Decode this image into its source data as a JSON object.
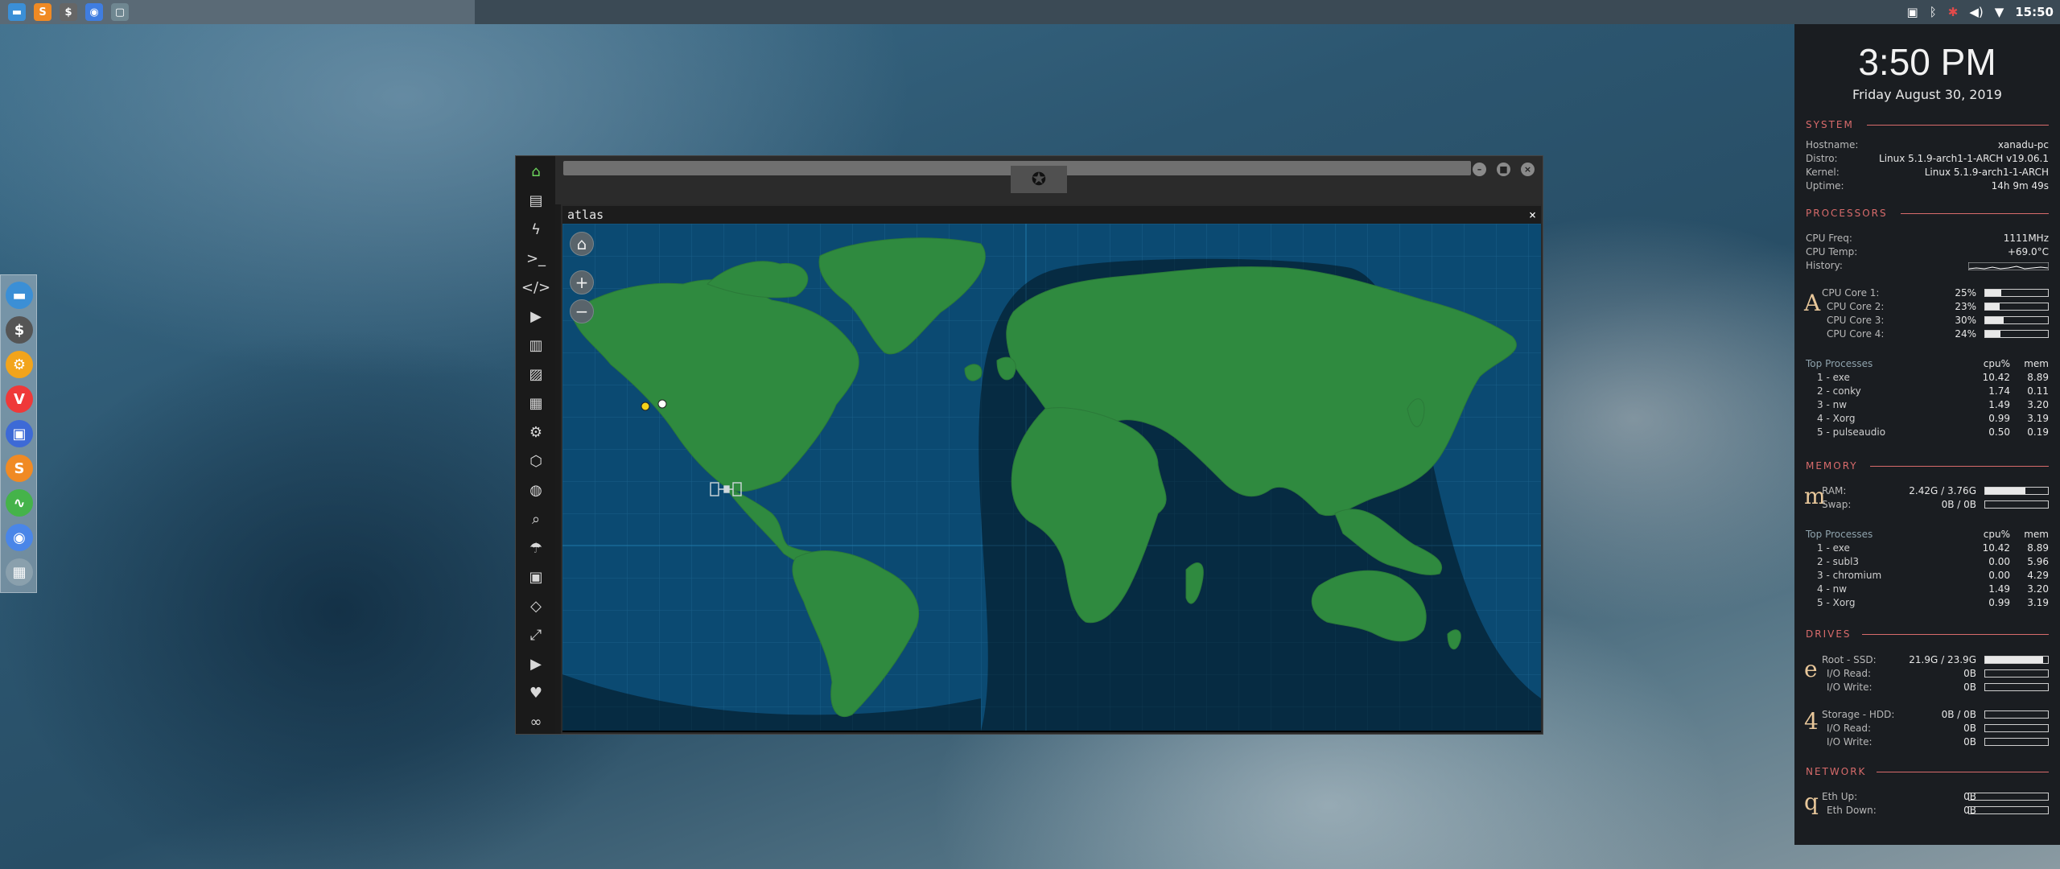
{
  "taskbar": {
    "launchers": [
      {
        "name": "files-icon",
        "glyph": "▬",
        "color": "#3b8fd6"
      },
      {
        "name": "sublime-icon",
        "glyph": "S",
        "color": "#f08a24"
      },
      {
        "name": "terminal-icon",
        "glyph": "$",
        "color": "#666"
      },
      {
        "name": "chromium-icon",
        "glyph": "◉",
        "color": "#3f7de0"
      },
      {
        "name": "atlas-icon",
        "glyph": "▢",
        "color": "#6f8791"
      }
    ],
    "time": "15:50"
  },
  "dock": {
    "items": [
      {
        "name": "files-icon",
        "glyph": "▬",
        "color": "#3b8fd6"
      },
      {
        "name": "terminal-icon",
        "glyph": "$",
        "color": "#555"
      },
      {
        "name": "settings-icon",
        "glyph": "⚙",
        "color": "#f2a41b"
      },
      {
        "name": "vivaldi-icon",
        "glyph": "V",
        "color": "#ef3939"
      },
      {
        "name": "screenshot-icon",
        "glyph": "▣",
        "color": "#3d6ad6"
      },
      {
        "name": "sublime-icon",
        "glyph": "S",
        "color": "#f08a24"
      },
      {
        "name": "monitor-icon",
        "glyph": "∿",
        "color": "#45b34a"
      },
      {
        "name": "chromium-icon",
        "glyph": "◉",
        "color": "#4a86e8"
      },
      {
        "name": "atlas-icon",
        "glyph": "▦",
        "color": "#8aa0ad"
      }
    ]
  },
  "window": {
    "sidebar_icons": [
      "home-icon",
      "document-icon",
      "bolt-icon",
      "terminal-icon",
      "code-icon",
      "play-icon",
      "ledger-icon",
      "image-icon",
      "news-icon",
      "settings-icon",
      "hexagon-icon",
      "globe-icon",
      "search-icon",
      "umbrella-icon",
      "contacts-icon",
      "code-brackets-icon",
      "expand-icon",
      "youtube-icon",
      "heart-icon",
      "infinity-icon"
    ],
    "app_title": "atlas",
    "close_glyph": "×"
  },
  "conky": {
    "time": "3:50 PM",
    "date": "Friday August 30, 2019",
    "system": {
      "title": "SYSTEM",
      "rows": [
        {
          "label": "Hostname:",
          "value": "xanadu-pc"
        },
        {
          "label": "Distro:",
          "value": "Linux 5.1.9-arch1-1-ARCH v19.06.1"
        },
        {
          "label": "Kernel:",
          "value": "Linux 5.1.9-arch1-1-ARCH"
        },
        {
          "label": "Uptime:",
          "value": "14h 9m 49s"
        }
      ]
    },
    "processors": {
      "title": "PROCESSORS",
      "freq_label": "CPU Freq:",
      "freq": "1111MHz",
      "temp_label": "CPU Temp:",
      "temp": "+69.0°C",
      "history_label": "History:",
      "letter": "A",
      "cores": [
        {
          "label": "CPU Core 1:",
          "value": "25%",
          "pct": 25
        },
        {
          "label": "CPU Core 2:",
          "value": "23%",
          "pct": 23
        },
        {
          "label": "CPU Core 3:",
          "value": "30%",
          "pct": 30
        },
        {
          "label": "CPU Core 4:",
          "value": "24%",
          "pct": 24
        }
      ],
      "top_label": "Top Processes",
      "col1": "cpu%",
      "col2": "mem",
      "procs": [
        {
          "name": "1 - exe",
          "cpu": "10.42",
          "mem": "8.89"
        },
        {
          "name": "2 - conky",
          "cpu": "1.74",
          "mem": "0.11"
        },
        {
          "name": "3 - nw",
          "cpu": "1.49",
          "mem": "3.20"
        },
        {
          "name": "4 - Xorg",
          "cpu": "0.99",
          "mem": "3.19"
        },
        {
          "name": "5 - pulseaudio",
          "cpu": "0.50",
          "mem": "0.19"
        }
      ]
    },
    "memory": {
      "title": "MEMORY",
      "letter": "m",
      "ram_label": "RAM:",
      "ram": "2.42G / 3.76G",
      "ram_pct": 64,
      "swap_label": "Swap:",
      "swap": "0B / 0B",
      "swap_pct": 0,
      "top_label": "Top Processes",
      "col1": "cpu%",
      "col2": "mem",
      "procs": [
        {
          "name": "1 - exe",
          "cpu": "10.42",
          "mem": "8.89"
        },
        {
          "name": "2 - subl3",
          "cpu": "0.00",
          "mem": "5.96"
        },
        {
          "name": "3 - chromium",
          "cpu": "0.00",
          "mem": "4.29"
        },
        {
          "name": "4 - nw",
          "cpu": "1.49",
          "mem": "3.20"
        },
        {
          "name": "5 - Xorg",
          "cpu": "0.99",
          "mem": "3.19"
        }
      ]
    },
    "drives": {
      "title": "DRIVES",
      "root_letter": "e",
      "root_label": "Root  -  SSD:",
      "root_value": "21.9G / 23.9G",
      "root_pct": 92,
      "root_read_label": "I/O Read:",
      "root_read": "0B",
      "root_write_label": "I/O Write:",
      "root_write": "0B",
      "storage_letter": "4",
      "storage_label": "Storage  -  HDD:",
      "storage_value": "0B / 0B",
      "storage_pct": 0,
      "storage_read_label": "I/O Read:",
      "storage_read": "0B",
      "storage_write_label": "I/O Write:",
      "storage_write": "0B"
    },
    "network": {
      "title": "NETWORK",
      "letter": "q",
      "up_label": "Eth Up:",
      "up": "0B",
      "down_label": "Eth Down:",
      "down": "0B"
    }
  }
}
